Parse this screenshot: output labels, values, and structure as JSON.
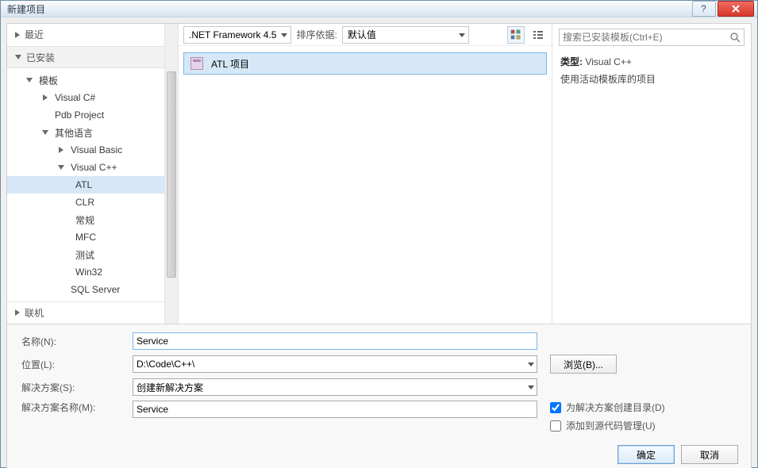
{
  "window": {
    "title": "新建项目"
  },
  "sidebar": {
    "recent": "最近",
    "installed": "已安装",
    "templates": "模板",
    "vcsharp": "Visual C#",
    "pdb": "Pdb Project",
    "otherlang": "其他语言",
    "vb": "Visual Basic",
    "vcpp": "Visual C++",
    "atl": "ATL",
    "clr": "CLR",
    "general": "常规",
    "mfc": "MFC",
    "test": "测试",
    "win32": "Win32",
    "sqlserver": "SQL Server",
    "online": "联机"
  },
  "toolbar": {
    "framework": ".NET Framework 4.5",
    "sortby_label": "排序依据:",
    "sortby_value": "默认值"
  },
  "items": [
    {
      "label": "ATL 项目"
    }
  ],
  "search": {
    "placeholder": "搜索已安装模板(Ctrl+E)"
  },
  "detail": {
    "type_label": "类型:",
    "type_value": "Visual C++",
    "description": "使用活动模板库的项目"
  },
  "form": {
    "name_label": "名称(N):",
    "name_value": "Service",
    "location_label": "位置(L):",
    "location_value": "D:\\Code\\C++\\",
    "solution_label": "解决方案(S):",
    "solution_value": "创建新解决方案",
    "solution_name_label": "解决方案名称(M):",
    "solution_name_value": "Service",
    "browse": "浏览(B)...",
    "chk_createdir": "为解决方案创建目录(D)",
    "chk_srcctl": "添加到源代码管理(U)"
  },
  "buttons": {
    "ok": "确定",
    "cancel": "取消"
  }
}
